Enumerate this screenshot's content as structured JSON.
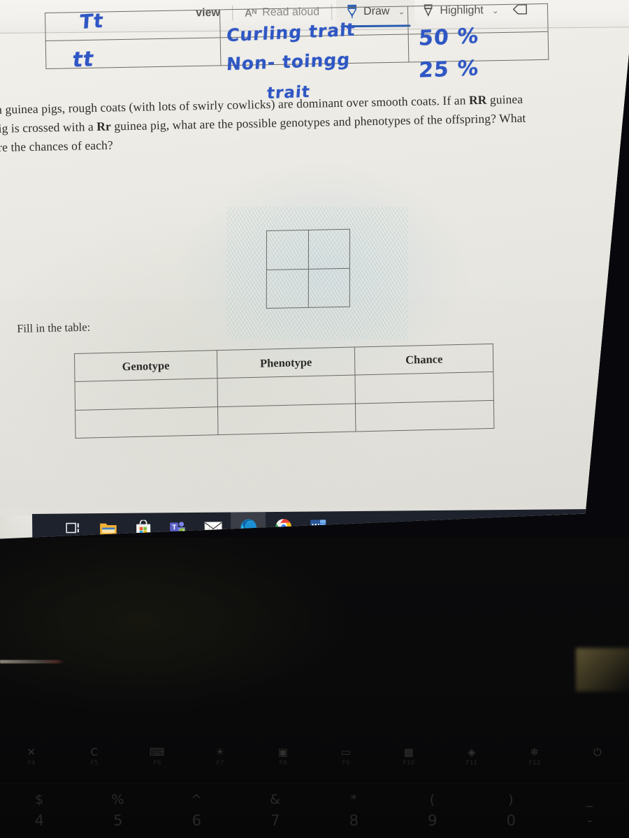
{
  "toolbar": {
    "page_view_label": "view",
    "read_aloud_label": "Read aloud",
    "read_aloud_icon": "Aᴺ",
    "draw_label": "Draw",
    "highlight_label": "Highlight",
    "chevron": "⌄",
    "pen_icon": "pen-icon",
    "highlighter_icon": "highlighter-icon",
    "eraser_icon": "eraser-icon",
    "active_accent": "#2a5db0"
  },
  "top_table": {
    "rows": [
      {
        "genotype": "Tt",
        "phenotype": "Curling trait",
        "chance": "50 %"
      },
      {
        "genotype": "tt",
        "phenotype": "Non- toingg",
        "chance": "25 %"
      }
    ],
    "trailing_ink": "trait",
    "ink_color": "#2f57c4"
  },
  "question": {
    "line1": "In guinea pigs, rough coats (with lots of swirly cowlicks) are dominant over smooth coats. If an ",
    "bold1": "RR",
    "line1_end": " guinea",
    "line2": "pig is crossed with a ",
    "bold2": "Rr",
    "line2_end": " guinea pig, what are the possible genotypes and phenotypes of the offspring? What",
    "line3": "are the chances of each?"
  },
  "punnett": {
    "cells": [
      "",
      "",
      "",
      ""
    ]
  },
  "fill_table": {
    "instruction": "Fill in the table:",
    "headers": [
      "Genotype",
      "Phenotype",
      "Chance"
    ],
    "rows": [
      [
        "",
        "",
        ""
      ],
      [
        "",
        "",
        ""
      ]
    ]
  },
  "taskbar": {
    "apps": [
      {
        "name": "task-view",
        "label": "Task View",
        "running": false,
        "active": false
      },
      {
        "name": "file-explorer",
        "label": "File Explorer",
        "running": false,
        "active": false
      },
      {
        "name": "microsoft-store",
        "label": "Microsoft Store",
        "running": false,
        "active": false
      },
      {
        "name": "microsoft-teams",
        "label": "Microsoft Teams",
        "running": true,
        "active": false
      },
      {
        "name": "mail",
        "label": "Mail",
        "running": false,
        "active": false
      },
      {
        "name": "microsoft-edge",
        "label": "Microsoft Edge",
        "running": true,
        "active": true
      },
      {
        "name": "google-chrome",
        "label": "Google Chrome",
        "running": true,
        "active": false
      },
      {
        "name": "microsoft-word",
        "label": "Microsoft Word",
        "running": true,
        "active": false
      }
    ],
    "tray": {
      "show_hidden_icons": "∧",
      "battery": "battery-icon"
    },
    "background": "#1e222c"
  },
  "keyboard": {
    "function_row": [
      {
        "glyph": "✕",
        "label": "F4"
      },
      {
        "glyph": "C",
        "label": "F5"
      },
      {
        "glyph": "⌨",
        "label": "F6"
      },
      {
        "glyph": "☀",
        "label": "F7"
      },
      {
        "glyph": "▣",
        "label": "F8"
      },
      {
        "glyph": "▭",
        "label": "F9"
      },
      {
        "glyph": "▦",
        "label": "F10"
      },
      {
        "glyph": "◈",
        "label": "F11"
      },
      {
        "glyph": "❄",
        "label": "F12"
      },
      {
        "glyph": "⏻",
        "label": ""
      }
    ],
    "number_row": [
      {
        "glyph": "$",
        "label": "4"
      },
      {
        "glyph": "%",
        "label": "5"
      },
      {
        "glyph": "^",
        "label": "6"
      },
      {
        "glyph": "&",
        "label": "7"
      },
      {
        "glyph": "*",
        "label": "8"
      },
      {
        "glyph": "(",
        "label": "9"
      },
      {
        "glyph": ")",
        "label": "0"
      },
      {
        "glyph": "_",
        "label": "-"
      }
    ]
  }
}
